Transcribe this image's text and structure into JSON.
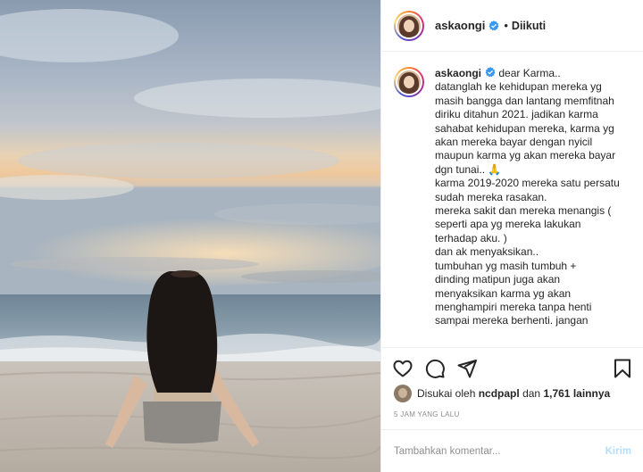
{
  "post": {
    "author": "askaongi",
    "follow_separator": "•",
    "follow_status": "Diikuti"
  },
  "caption": {
    "author": "askaongi",
    "lines": [
      "dear Karma..",
      "datanglah ke kehidupan mereka yg",
      "masih bangga dan lantang memfitnah",
      "diriku ditahun 2021. jadikan karma",
      "sahabat kehidupan mereka, karma yg",
      "akan mereka bayar dengan nyicil",
      "maupun karma yg akan mereka bayar",
      "dgn tunai.. 🙏",
      "karma 2019-2020 mereka satu persatu",
      "sudah mereka rasakan.",
      "mereka sakit dan mereka menangis (",
      "seperti apa yg mereka lakukan",
      "terhadap aku. )",
      "dan ak menyaksikan..",
      "tumbuhan yg masih tumbuh +",
      "dinding matipun juga akan",
      "menyaksikan karma yg akan",
      "menghampiri mereka tanpa henti",
      "sampai mereka berhenti. jangan"
    ]
  },
  "likes": {
    "prefix": "Disukai oleh",
    "liker": "ncdpapl",
    "middle": "dan",
    "count": "1,761 lainnya"
  },
  "timestamp": "5 JAM YANG LALU",
  "comment": {
    "placeholder": "Tambahkan komentar...",
    "post_label": "Kirim"
  },
  "icons": {
    "like": "heart-icon",
    "comment": "comment-icon",
    "share": "send-icon",
    "save": "bookmark-icon",
    "verified": "verified-badge-icon"
  },
  "colors": {
    "verified": "#3897f0",
    "post_button_disabled": "#b2dffc",
    "muted_text": "#8e8e8e"
  }
}
